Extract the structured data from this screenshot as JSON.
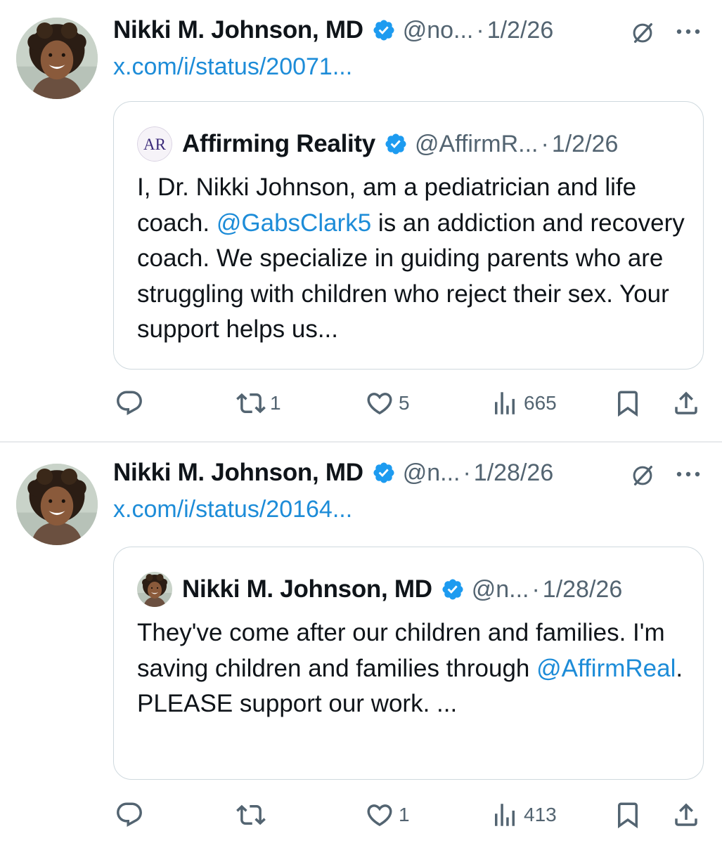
{
  "tweets": [
    {
      "author": {
        "name": "Nikki M. Johnson, MD",
        "handle": "@no...",
        "avatar_icon": "profile-photo"
      },
      "date": "1/2/26",
      "link": "x.com/i/status/20071...",
      "quoted": {
        "author": {
          "name": "Affirming Reality",
          "handle": "@AffirmR...",
          "avatar_text": "AR"
        },
        "date": "1/2/26",
        "text_parts": [
          "I, Dr. Nikki Johnson, am a pediatrician and life coach. ",
          "@GabsClark5",
          " is an addiction and recovery coach. We specialize in guiding parents who are struggling with children who reject their sex. Your support helps us..."
        ]
      },
      "stats": {
        "replies": "",
        "reposts": "1",
        "likes": "5",
        "views": "665"
      }
    },
    {
      "author": {
        "name": "Nikki M. Johnson, MD",
        "handle": "@n...",
        "avatar_icon": "profile-photo"
      },
      "date": "1/28/26",
      "link": "x.com/i/status/20164...",
      "quoted": {
        "author": {
          "name": "Nikki M. Johnson, MD",
          "handle": "@n...",
          "avatar_icon": "profile-photo"
        },
        "date": "1/28/26",
        "text_parts": [
          "They've come after our children and families. I'm saving children and families through ",
          "@AffirmReal",
          ". PLEASE support our work. ..."
        ]
      },
      "stats": {
        "replies": "",
        "reposts": "",
        "likes": "1",
        "views": "413"
      }
    }
  ],
  "colors": {
    "accent": "#1d8cd8",
    "secondary_text": "#536471",
    "verified": "#1d9bf0",
    "border": "#cfd9de"
  },
  "icons": [
    "verified-badge",
    "grok-icon",
    "more-icon",
    "reply-icon",
    "repost-icon",
    "like-icon",
    "views-icon",
    "bookmark-icon",
    "share-icon"
  ]
}
